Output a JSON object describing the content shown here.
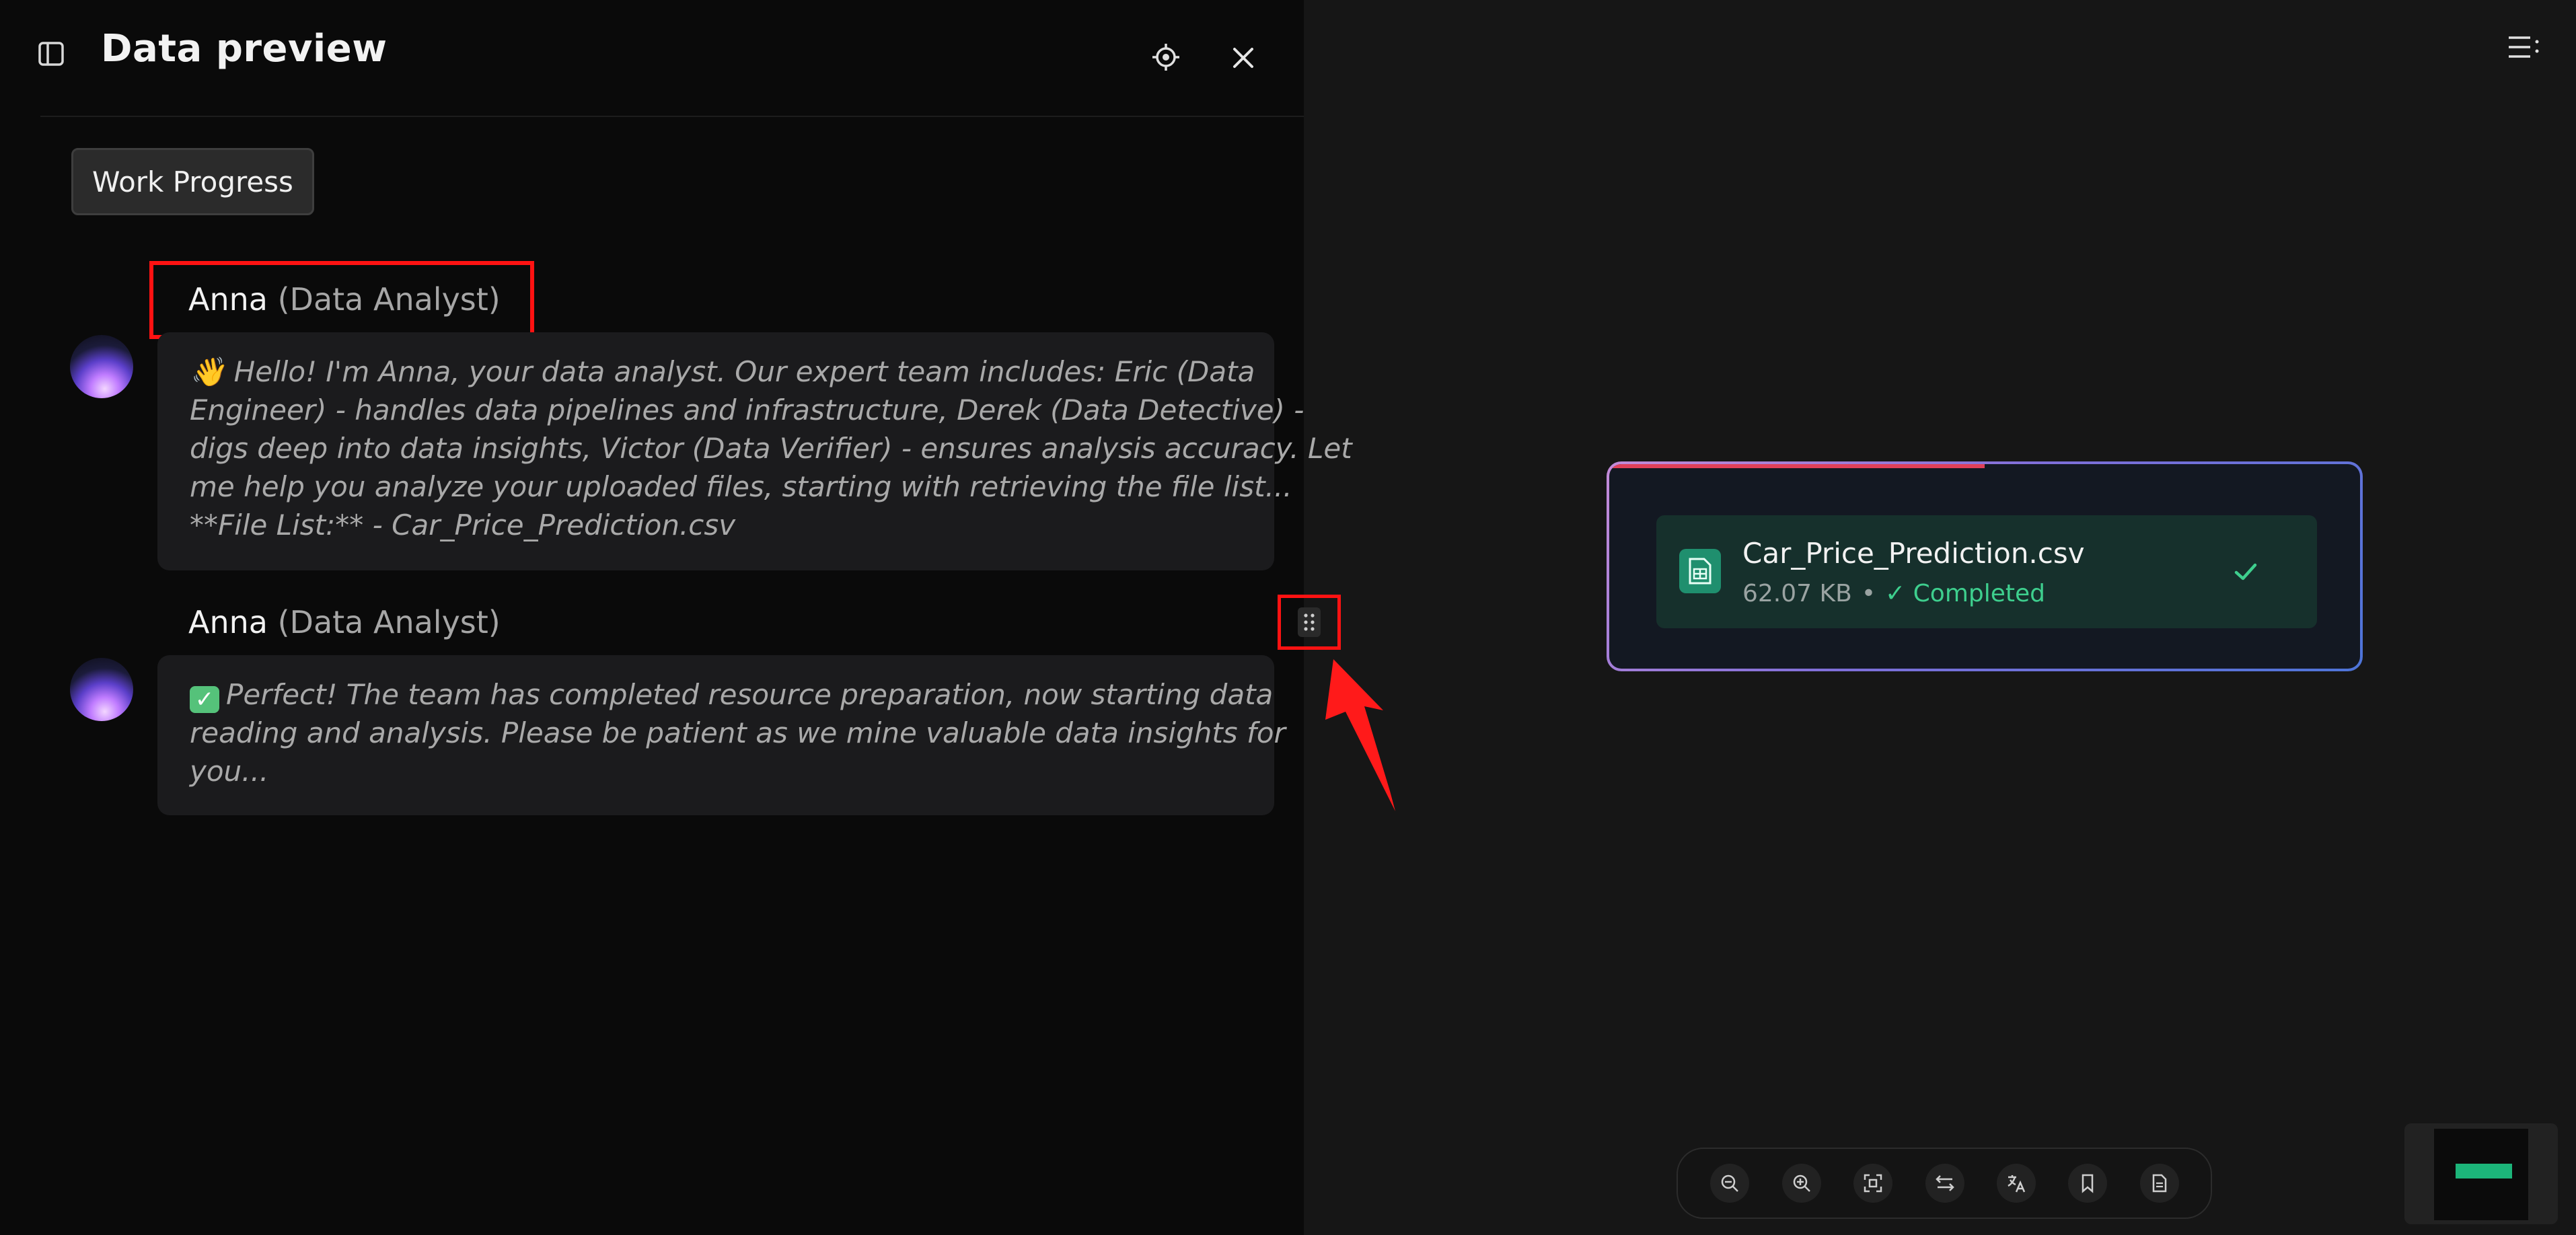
{
  "header": {
    "title": "Data preview"
  },
  "work_progress_label": "Work Progress",
  "messages": [
    {
      "sender": "Anna",
      "role": "(Data Analyst)",
      "lines": [
        "👋 Hello! I'm Anna, your data analyst. Our expert team includes: Eric (Data",
        "Engineer) - handles data pipelines and infrastructure, Derek (Data Detective) -",
        "digs deep into data insights, Victor (Data Verifier) - ensures analysis accuracy. Let",
        "me help you analyze your uploaded files, starting with retrieving the file list...",
        "**File List:** - Car_Price_Prediction.csv"
      ]
    },
    {
      "sender": "Anna",
      "role": "(Data Analyst)",
      "lines": [
        "Perfect! The team has completed resource preparation, now starting data",
        "reading and analysis. Please be patient as we mine valuable data insights for",
        "you..."
      ]
    }
  ],
  "upload": {
    "file_name": "Car_Price_Prediction.csv",
    "file_size": "62.07 KB",
    "separator": "•",
    "status": "✓ Completed",
    "progress": 0.5
  },
  "toolbar_icons": [
    "zoom-out-icon",
    "zoom-in-icon",
    "fit-screen-icon",
    "swap-icon",
    "translate-icon",
    "bookmark-icon",
    "document-icon"
  ],
  "colors": {
    "accent_green": "#3ecf8e",
    "annotation_red": "#ff1212",
    "panel_bg": "#0a0a0a",
    "canvas_bg": "#161616"
  }
}
